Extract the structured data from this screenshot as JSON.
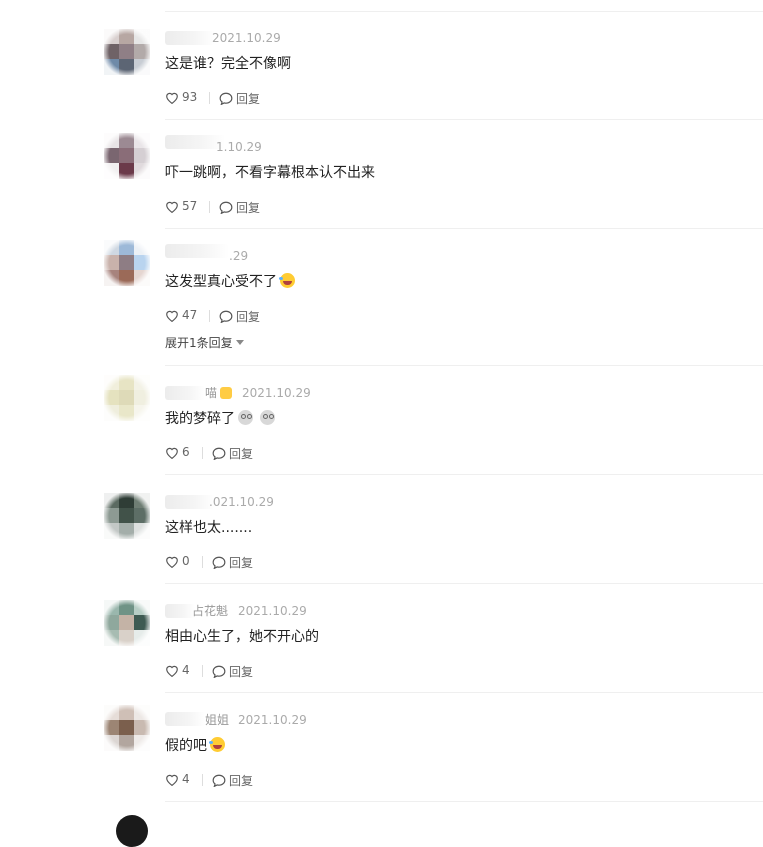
{
  "comments": [
    {
      "name_tail": "",
      "date": "2021.10.29",
      "text": "这是谁？完全不像啊",
      "likes": "93",
      "reply_label": "回复",
      "avatar_colors": [
        "#d9d0cf",
        "#b7a7a3",
        "#e6e6e6",
        "#6f6266",
        "#8f7f86",
        "#b2aaa9",
        "#6f8aa8",
        "#5c6574",
        "#c8cdd4"
      ]
    },
    {
      "name_tail": "",
      "date": "1.10.29",
      "text": "吓一跳啊，不看字幕根本认不出来",
      "likes": "57",
      "reply_label": "回复",
      "avatar_colors": [
        "#e8e4e6",
        "#9c8a93",
        "#e9e5e8",
        "#7a6670",
        "#8a6d78",
        "#d5cfd3",
        "#f1eff0",
        "#6b3a4a",
        "#e0dadd"
      ]
    },
    {
      "name_tail": "",
      "date": ".29",
      "text": "这发型真心受不了",
      "text_emoji": "laugh",
      "likes": "47",
      "reply_label": "回复",
      "expand_label": "展开1条回复",
      "avatar_colors": [
        "#cfd8e2",
        "#9db9d8",
        "#ecf1f6",
        "#c9b2ab",
        "#8e7d84",
        "#b9d4ef",
        "#a7837d",
        "#9b6a58",
        "#e5d6d1"
      ]
    },
    {
      "name_tail": "喵",
      "name_emoji": "cat",
      "date": "2021.10.29",
      "text": "我的梦碎了",
      "text_emoji": "dizzy2",
      "likes": "6",
      "reply_label": "回复",
      "avatar_colors": [
        "#f1efdc",
        "#e7e4c4",
        "#f3f2e6",
        "#e5e2bf",
        "#deda b8",
        "#f0efe0",
        "#efeedd",
        "#e9e7c9",
        "#f6f5ec"
      ]
    },
    {
      "name_tail": "",
      "date": ".021.10.29",
      "text": "这样也太.......",
      "likes": "0",
      "reply_label": "回复",
      "avatar_colors": [
        "#5b6a61",
        "#2f3d36",
        "#6f7e74",
        "#8d9a93",
        "#415249",
        "#5d6e66",
        "#c3c8c6",
        "#a4aeaa",
        "#dde0df"
      ]
    },
    {
      "name_tail": "占花魁",
      "date": "2021.10.29",
      "text": "相由心生了，她不开心的",
      "likes": "4",
      "reply_label": "回复",
      "avatar_colors": [
        "#9ab7ad",
        "#6f9386",
        "#b7cec5",
        "#8fa89d",
        "#c4b3a6",
        "#3e5b52",
        "#a7bcb2",
        "#d9d1c9",
        "#e6ecea"
      ]
    },
    {
      "name_tail": "姐姐",
      "date": "2021.10.29",
      "text": "假的吧",
      "text_emoji": "laugh",
      "likes": "4",
      "reply_label": "回复",
      "avatar_colors": [
        "#e6ddd8",
        "#cfbfb6",
        "#ede8e5",
        "#9c8574",
        "#7b5f4d",
        "#c9bab1",
        "#dcd6d3",
        "#b2a69f",
        "#eeeae8"
      ]
    }
  ]
}
